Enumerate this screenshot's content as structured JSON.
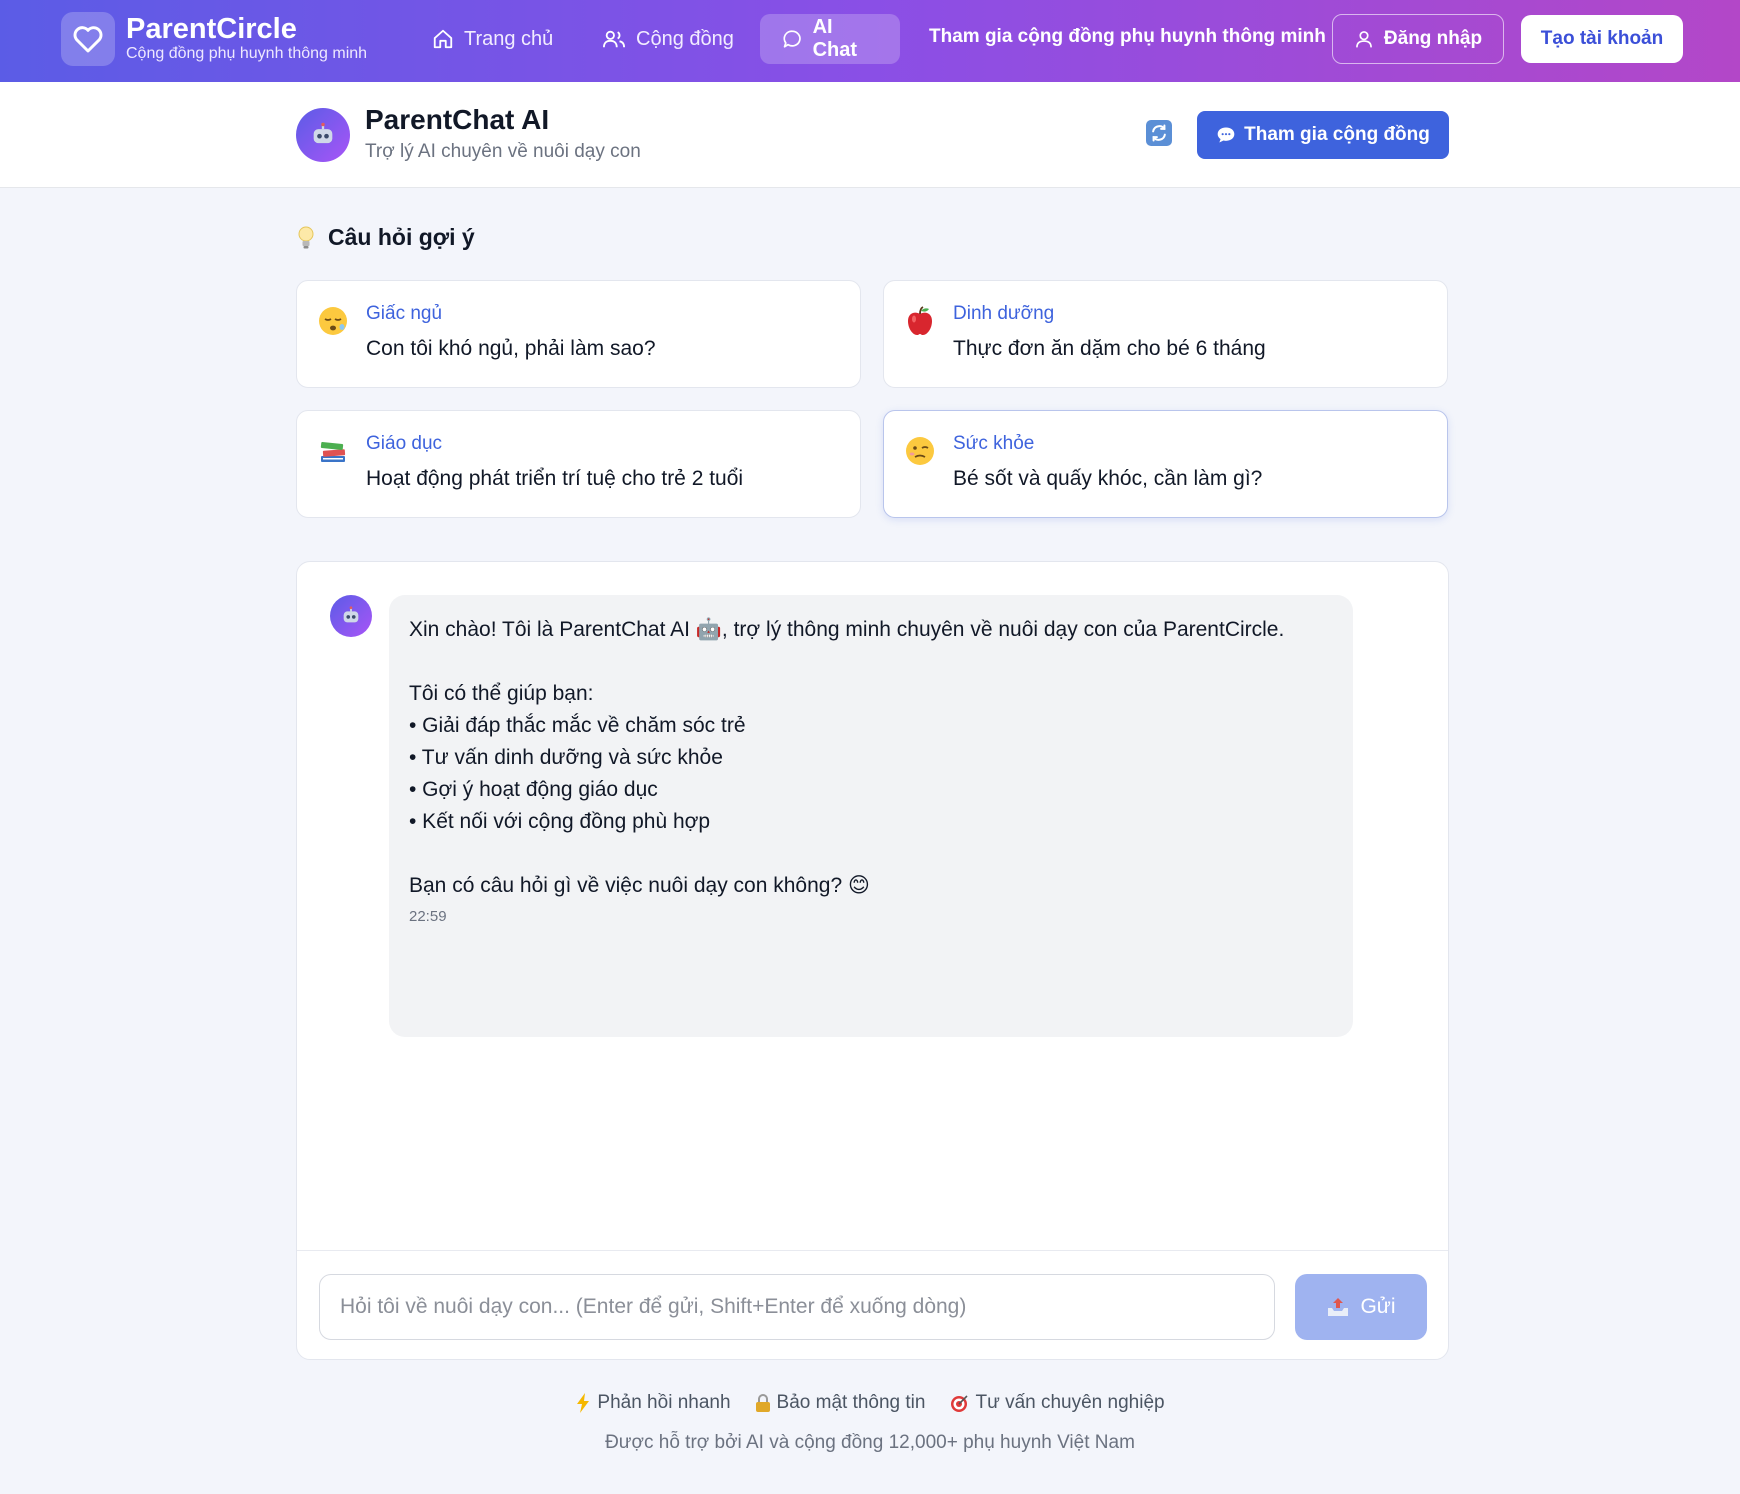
{
  "brand": {
    "name": "ParentCircle",
    "tagline": "Cộng đồng phụ huynh thông minh"
  },
  "nav": {
    "items": [
      {
        "label": "Trang chủ",
        "icon": "home-icon"
      },
      {
        "label": "Cộng đồng",
        "icon": "users-icon"
      },
      {
        "label": "AI Chat",
        "icon": "chat-bubble-icon",
        "active": true
      }
    ],
    "slogan": "Tham gia cộng đồng phụ huynh thông minh",
    "login_label": "Đăng nhập",
    "signup_label": "Tạo tài khoản"
  },
  "chat_header": {
    "title": "ParentChat AI",
    "subtitle": "Trợ lý AI chuyên về nuôi dạy con",
    "join_label": "Tham gia cộng đồng"
  },
  "suggestions": {
    "heading": "Câu hỏi gợi ý",
    "cards": [
      {
        "icon": "sleepy-face-icon",
        "category": "Giấc ngủ",
        "question": "Con tôi khó ngủ, phải làm sao?"
      },
      {
        "icon": "apple-icon",
        "category": "Dinh dưỡng",
        "question": "Thực đơn ăn dặm cho bé 6 tháng"
      },
      {
        "icon": "books-icon",
        "category": "Giáo dục",
        "question": "Hoạt động phát triển trí tuệ cho trẻ 2 tuổi"
      },
      {
        "icon": "feverish-face-icon",
        "category": "Sức khỏe",
        "question": "Bé sốt và quấy khóc, cần làm gì?"
      }
    ]
  },
  "messages": [
    {
      "sender": "bot",
      "text": "Xin chào! Tôi là ParentChat AI 🤖, trợ lý thông minh chuyên về nuôi dạy con của ParentCircle.\n\nTôi có thể giúp bạn:\n• Giải đáp thắc mắc về chăm sóc trẻ\n• Tư vấn dinh dưỡng và sức khỏe\n• Gợi ý hoạt động giáo dục\n• Kết nối với cộng đồng phù hợp\n\nBạn có câu hỏi gì về việc nuôi dạy con không? 😊",
      "time": "22:59"
    }
  ],
  "input": {
    "placeholder": "Hỏi tôi về nuôi dạy con... (Enter để gửi, Shift+Enter để xuống dòng)",
    "value": "",
    "send_label": "Gửi"
  },
  "footer": {
    "features": [
      {
        "icon": "lightning-icon",
        "label": "Phản hồi nhanh"
      },
      {
        "icon": "lock-icon",
        "label": "Bảo mật thông tin"
      },
      {
        "icon": "target-icon",
        "label": "Tư vấn chuyên nghiệp"
      }
    ],
    "note": "Được hỗ trợ bởi AI và cộng đồng 12,000+ phụ huynh Việt Nam"
  },
  "colors": {
    "accent": "#3e63dd",
    "nav_gradient_start": "#5b5ce6",
    "nav_gradient_end": "#b347c8"
  }
}
